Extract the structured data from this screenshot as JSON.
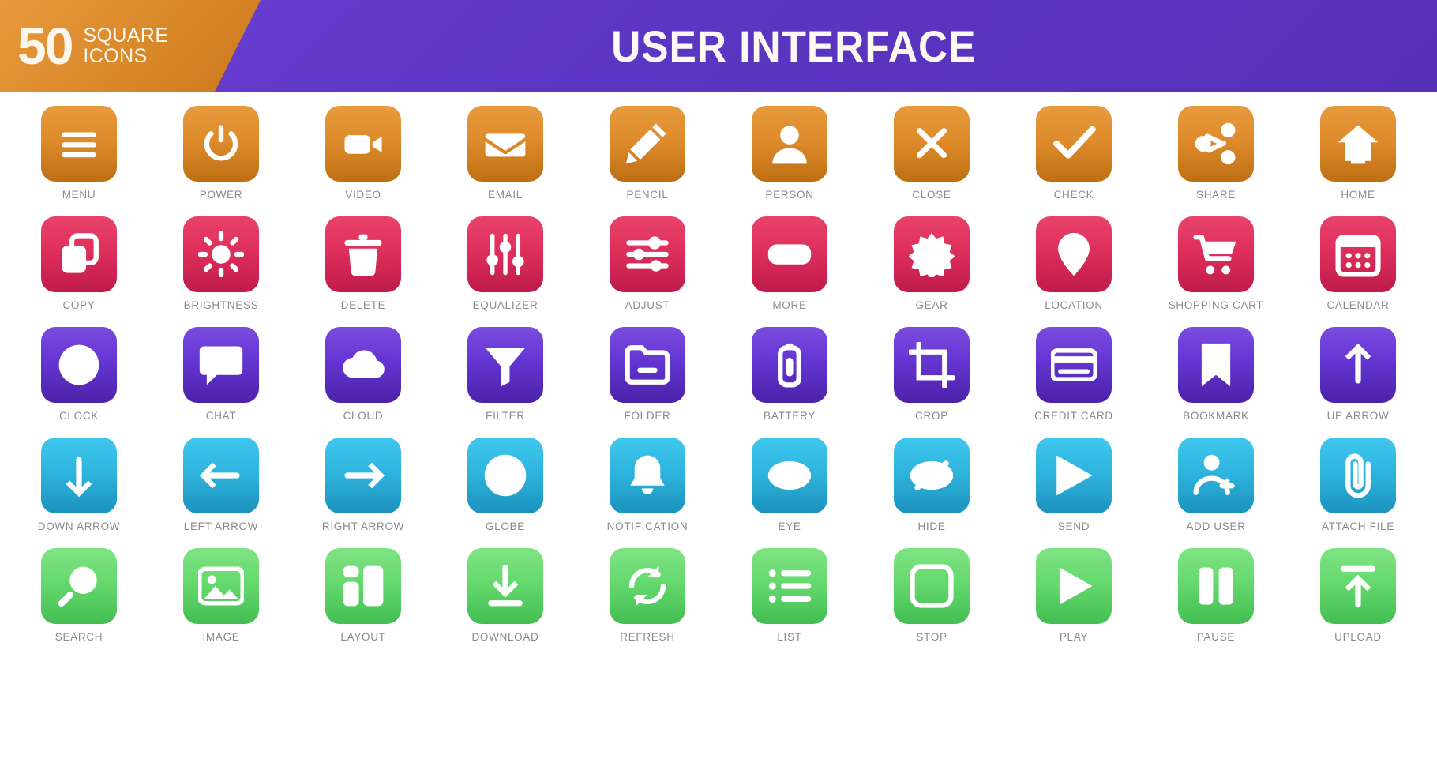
{
  "header": {
    "badge_number": "50",
    "badge_line1": "SQUARE",
    "badge_line2": "ICONS",
    "title": "USER INTERFACE",
    "badge_color": "#d98829",
    "title_bg_color": "#5b36c2"
  },
  "label_color": "#8a8a8f",
  "rows": [
    {
      "palette_name": "orange",
      "color_start": "#e79b3d",
      "color_end": "#bd6f12",
      "icons": [
        {
          "label": "MENU",
          "icon": "menu-icon"
        },
        {
          "label": "POWER",
          "icon": "power-icon"
        },
        {
          "label": "VIDEO",
          "icon": "video-icon"
        },
        {
          "label": "EMAIL",
          "icon": "email-icon"
        },
        {
          "label": "PENCIL",
          "icon": "pencil-icon"
        },
        {
          "label": "PERSON",
          "icon": "person-icon"
        },
        {
          "label": "CLOSE",
          "icon": "close-icon"
        },
        {
          "label": "CHECK",
          "icon": "check-icon"
        },
        {
          "label": "SHARE",
          "icon": "share-icon"
        },
        {
          "label": "HOME",
          "icon": "home-icon"
        }
      ]
    },
    {
      "palette_name": "crimson",
      "color_start": "#e8436b",
      "color_end": "#bf1b4a",
      "icons": [
        {
          "label": "COPY",
          "icon": "copy-icon"
        },
        {
          "label": "BRIGHTNESS",
          "icon": "brightness-icon"
        },
        {
          "label": "DELETE",
          "icon": "delete-icon"
        },
        {
          "label": "EQUALIZER",
          "icon": "equalizer-icon"
        },
        {
          "label": "ADJUST",
          "icon": "adjust-icon"
        },
        {
          "label": "MORE",
          "icon": "more-icon"
        },
        {
          "label": "GEAR",
          "icon": "gear-icon"
        },
        {
          "label": "LOCATION",
          "icon": "location-icon"
        },
        {
          "label": "SHOPPING CART",
          "icon": "shopping-cart-icon"
        },
        {
          "label": "CALENDAR",
          "icon": "calendar-icon"
        }
      ]
    },
    {
      "palette_name": "purple",
      "color_start": "#7b4ce0",
      "color_end": "#4b22a8",
      "icons": [
        {
          "label": "CLOCK",
          "icon": "clock-icon"
        },
        {
          "label": "CHAT",
          "icon": "chat-icon"
        },
        {
          "label": "CLOUD",
          "icon": "cloud-icon"
        },
        {
          "label": "FILTER",
          "icon": "filter-icon"
        },
        {
          "label": "FOLDER",
          "icon": "folder-icon"
        },
        {
          "label": "BATTERY",
          "icon": "battery-icon"
        },
        {
          "label": "CROP",
          "icon": "crop-icon"
        },
        {
          "label": "CREDIT CARD",
          "icon": "credit-card-icon"
        },
        {
          "label": "BOOKMARK",
          "icon": "bookmark-icon"
        },
        {
          "label": "UP ARROW",
          "icon": "up-arrow-icon"
        }
      ]
    },
    {
      "palette_name": "cyan",
      "color_start": "#3fc8ef",
      "color_end": "#1b93bd",
      "icons": [
        {
          "label": "DOWN ARROW",
          "icon": "down-arrow-icon"
        },
        {
          "label": "LEFT ARROW",
          "icon": "left-arrow-icon"
        },
        {
          "label": "RIGHT ARROW",
          "icon": "right-arrow-icon"
        },
        {
          "label": "GLOBE",
          "icon": "globe-icon"
        },
        {
          "label": "NOTIFICATION",
          "icon": "notification-icon"
        },
        {
          "label": "EYE",
          "icon": "eye-icon"
        },
        {
          "label": "HIDE",
          "icon": "hide-icon"
        },
        {
          "label": "SEND",
          "icon": "send-icon"
        },
        {
          "label": "ADD USER",
          "icon": "add-user-icon"
        },
        {
          "label": "ATTACH FILE",
          "icon": "attach-file-icon"
        }
      ]
    },
    {
      "palette_name": "green",
      "color_start": "#7fe383",
      "color_end": "#43be52",
      "icons": [
        {
          "label": "SEARCH",
          "icon": "search-icon"
        },
        {
          "label": "IMAGE",
          "icon": "image-icon"
        },
        {
          "label": "LAYOUT",
          "icon": "layout-icon"
        },
        {
          "label": "DOWNLOAD",
          "icon": "download-icon"
        },
        {
          "label": "REFRESH",
          "icon": "refresh-icon"
        },
        {
          "label": "LIST",
          "icon": "list-icon"
        },
        {
          "label": "STOP",
          "icon": "stop-icon"
        },
        {
          "label": "PLAY",
          "icon": "play-icon"
        },
        {
          "label": "PAUSE",
          "icon": "pause-icon"
        },
        {
          "label": "UPLOAD",
          "icon": "upload-icon"
        }
      ]
    }
  ]
}
